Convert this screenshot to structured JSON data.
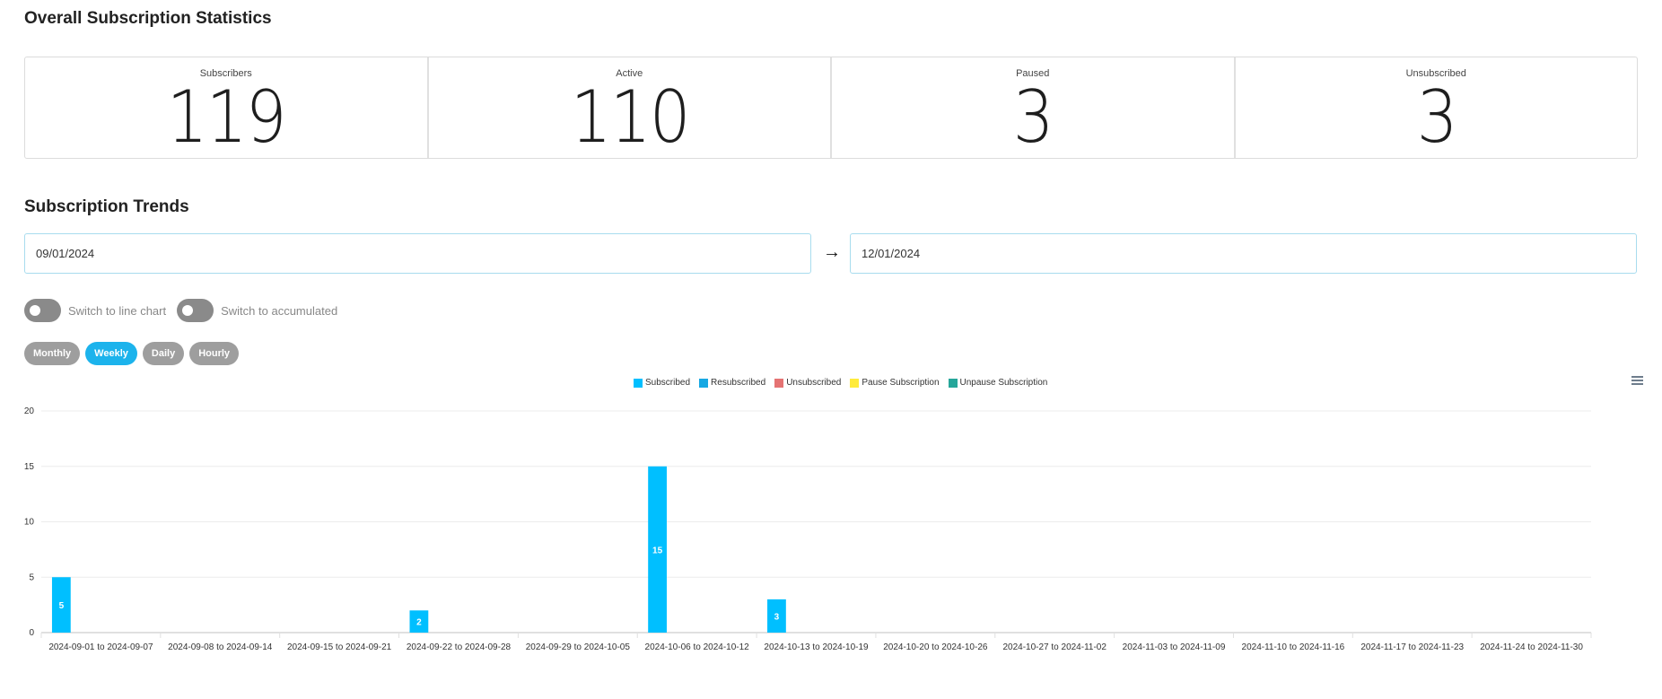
{
  "stats_section": {
    "title": "Overall Subscription Statistics",
    "cards": [
      {
        "label": "Subscribers",
        "value": "119"
      },
      {
        "label": "Active",
        "value": "110"
      },
      {
        "label": "Paused",
        "value": "3"
      },
      {
        "label": "Unsubscribed",
        "value": "3"
      }
    ]
  },
  "trends_section": {
    "title": "Subscription Trends",
    "start_date": "09/01/2024",
    "end_date": "12/01/2024",
    "arrow_icon": "→",
    "toggles": [
      {
        "label": "Switch to line chart",
        "on": false
      },
      {
        "label": "Switch to accumulated",
        "on": false
      }
    ],
    "periods": [
      {
        "label": "Monthly",
        "active": false
      },
      {
        "label": "Weekly",
        "active": true
      },
      {
        "label": "Daily",
        "active": false
      },
      {
        "label": "Hourly",
        "active": false
      }
    ]
  },
  "chart_data": {
    "type": "bar",
    "title": "",
    "xlabel": "",
    "ylabel": "",
    "ylim": [
      0,
      20
    ],
    "yticks": [
      0,
      5,
      10,
      15,
      20
    ],
    "grid": true,
    "legend_position": "top-center",
    "categories": [
      "2024-09-01 to 2024-09-07",
      "2024-09-08 to 2024-09-14",
      "2024-09-15 to 2024-09-21",
      "2024-09-22 to 2024-09-28",
      "2024-09-29 to 2024-10-05",
      "2024-10-06 to 2024-10-12",
      "2024-10-13 to 2024-10-19",
      "2024-10-20 to 2024-10-26",
      "2024-10-27 to 2024-11-02",
      "2024-11-03 to 2024-11-09",
      "2024-11-10 to 2024-11-16",
      "2024-11-17 to 2024-11-23",
      "2024-11-24 to 2024-11-30"
    ],
    "series": [
      {
        "name": "Subscribed",
        "color": "#00bfff",
        "values": [
          5,
          0,
          0,
          2,
          0,
          15,
          3,
          0,
          0,
          0,
          0,
          0,
          0
        ]
      },
      {
        "name": "Resubscribed",
        "color": "#17a8e3",
        "values": [
          0,
          0,
          0,
          0,
          0,
          0,
          0,
          0,
          0,
          0,
          0,
          0,
          0
        ]
      },
      {
        "name": "Unsubscribed",
        "color": "#e57373",
        "values": [
          0,
          0,
          0,
          0,
          0,
          0,
          0,
          0,
          0,
          0,
          0,
          0,
          0
        ]
      },
      {
        "name": "Pause Subscription",
        "color": "#ffeb3b",
        "values": [
          0,
          0,
          0,
          0,
          0,
          0,
          0,
          0,
          0,
          0,
          0,
          0,
          0
        ]
      },
      {
        "name": "Unpause Subscription",
        "color": "#26a69a",
        "values": [
          0,
          0,
          0,
          0,
          0,
          0,
          0,
          0,
          0,
          0,
          0,
          0,
          0
        ]
      }
    ]
  },
  "chart_menu_icon": "hamburger-menu"
}
